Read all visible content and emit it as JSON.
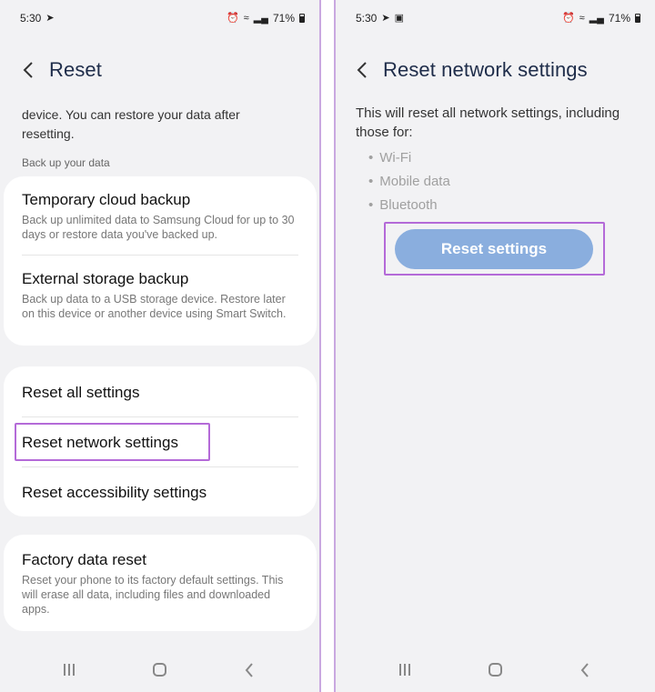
{
  "left_screen": {
    "status": {
      "time": "5:30",
      "battery": "71%"
    },
    "header": {
      "title": "Reset"
    },
    "intro_text": "device. You can restore your data after resetting.",
    "section_label": "Back up your data",
    "backup_items": [
      {
        "title": "Temporary cloud backup",
        "desc": "Back up unlimited data to Samsung Cloud for up to 30 days or restore data you've backed up."
      },
      {
        "title": "External storage backup",
        "desc": "Back up data to a USB storage device. Restore later on this device or another device using Smart Switch."
      }
    ],
    "settings_items": [
      {
        "title": "Reset all settings"
      },
      {
        "title": "Reset network settings"
      },
      {
        "title": "Reset accessibility settings"
      }
    ],
    "factory_item": {
      "title": "Factory data reset",
      "desc": "Reset your phone to its factory default settings. This will erase all data, including files and downloaded apps."
    }
  },
  "right_screen": {
    "status": {
      "time": "5:30",
      "battery": "71%"
    },
    "header": {
      "title": "Reset network settings"
    },
    "description": "This will reset all network settings, including those for:",
    "bullets": [
      "Wi-Fi",
      "Mobile data",
      "Bluetooth"
    ],
    "button_label": "Reset settings"
  },
  "colors": {
    "accent_highlight": "#b46ad8",
    "button_bg": "#8aaede",
    "background": "#f2f2f4"
  },
  "icons": [
    "back-arrow-icon",
    "send-icon",
    "gallery-icon",
    "alarm-icon",
    "wifi-icon",
    "signal-icon",
    "battery-icon",
    "recent-apps-icon",
    "home-icon"
  ]
}
